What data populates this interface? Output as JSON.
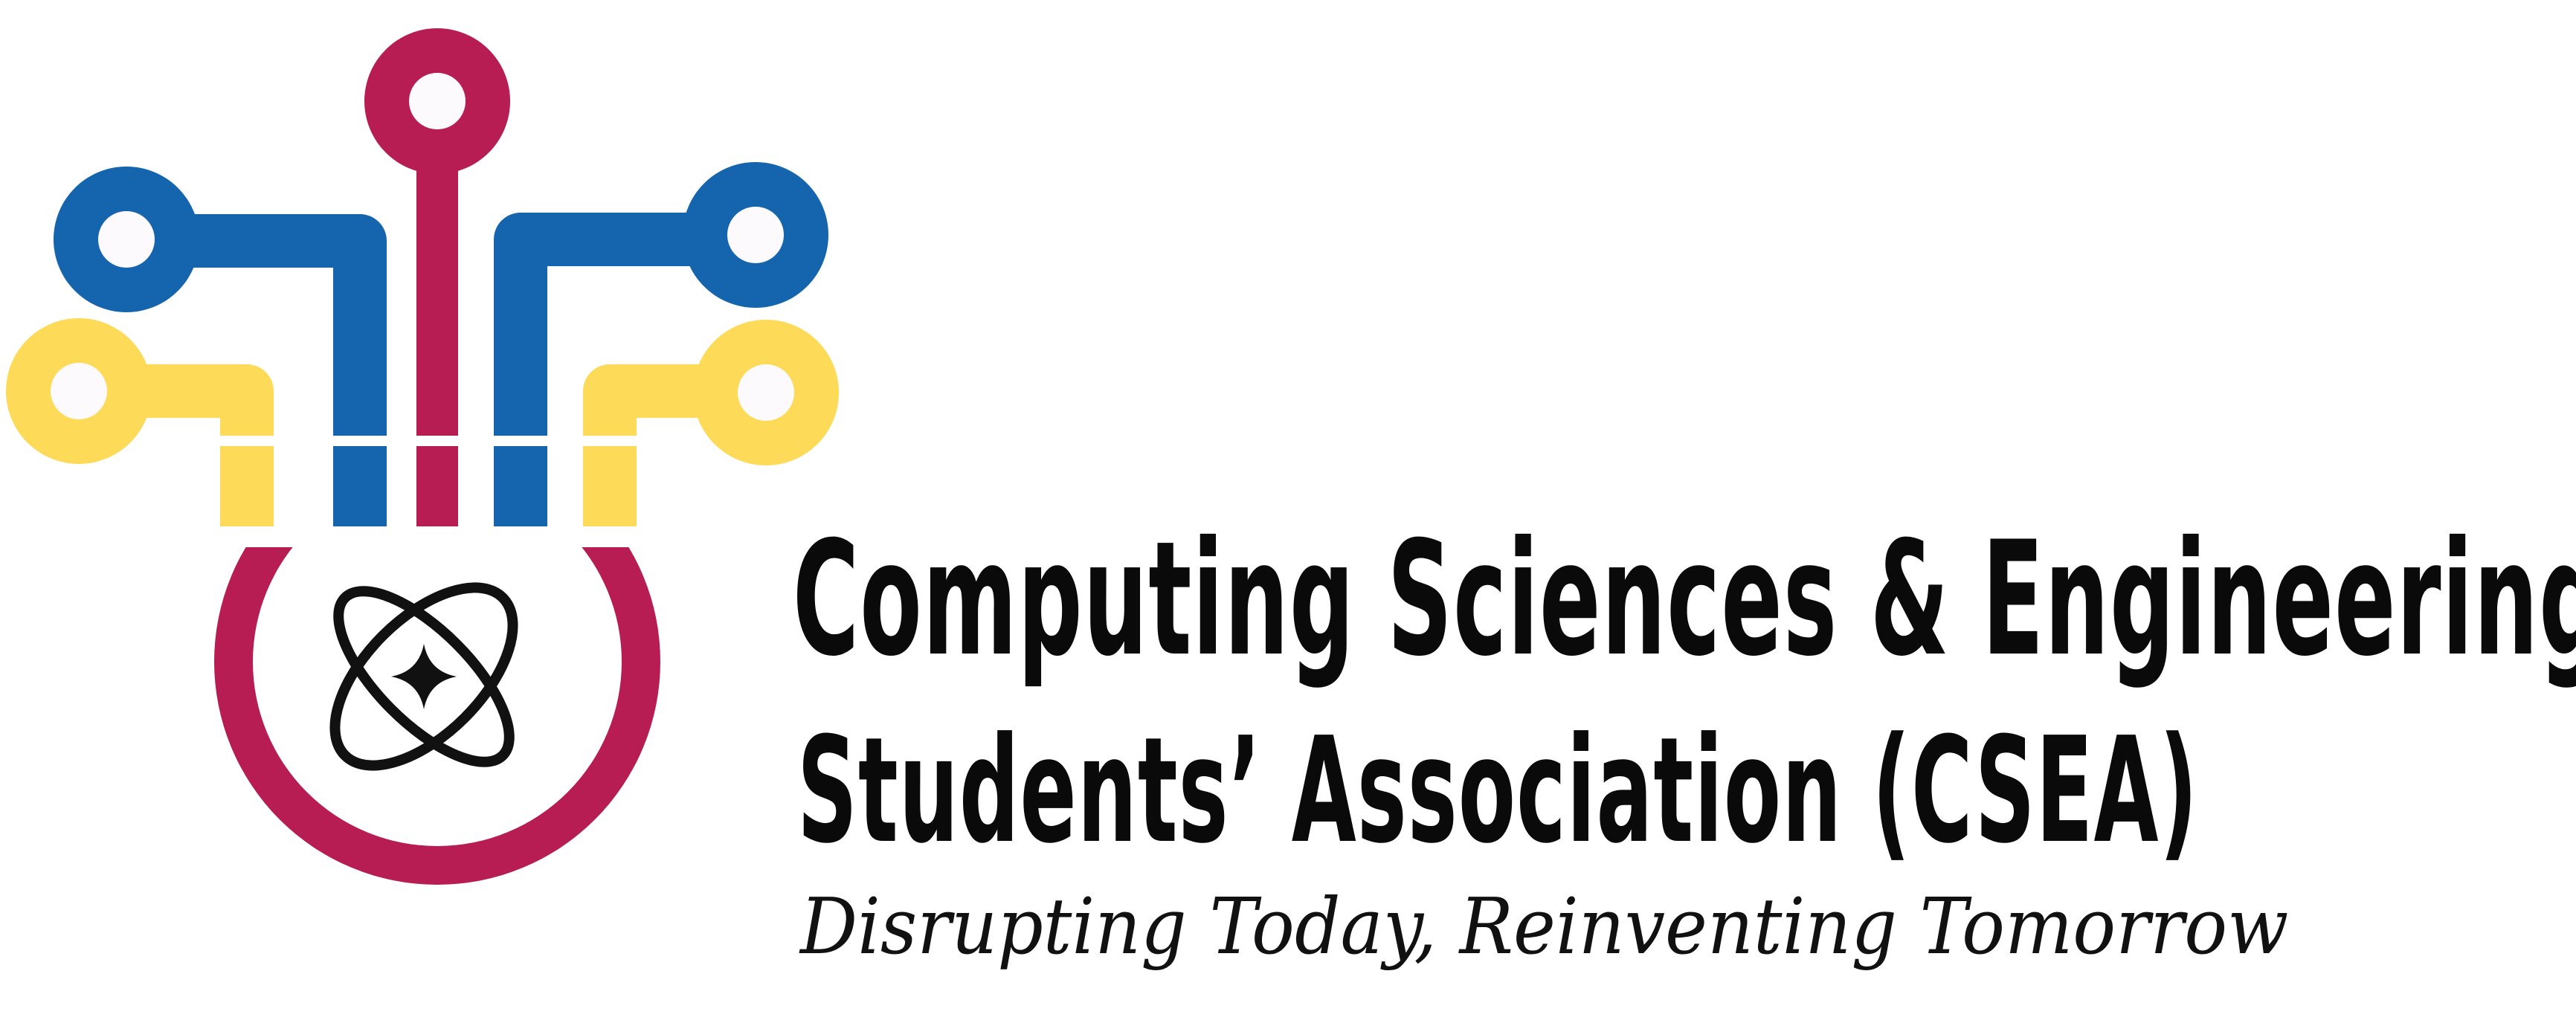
{
  "brand": {
    "line_1": "Computing Sciences & Engineering",
    "line_2": "Students’ Association (CSEA)",
    "tagline": "Disrupting Today, Reinventing Tomorrow"
  },
  "logo": {
    "icon": "gear-circuit-atom-icon",
    "colors": {
      "magenta": "#B71C52",
      "blue": "#1565AE",
      "yellow": "#FDDA57",
      "node_fill": "#FCFAFC",
      "atom": "#111111"
    }
  }
}
